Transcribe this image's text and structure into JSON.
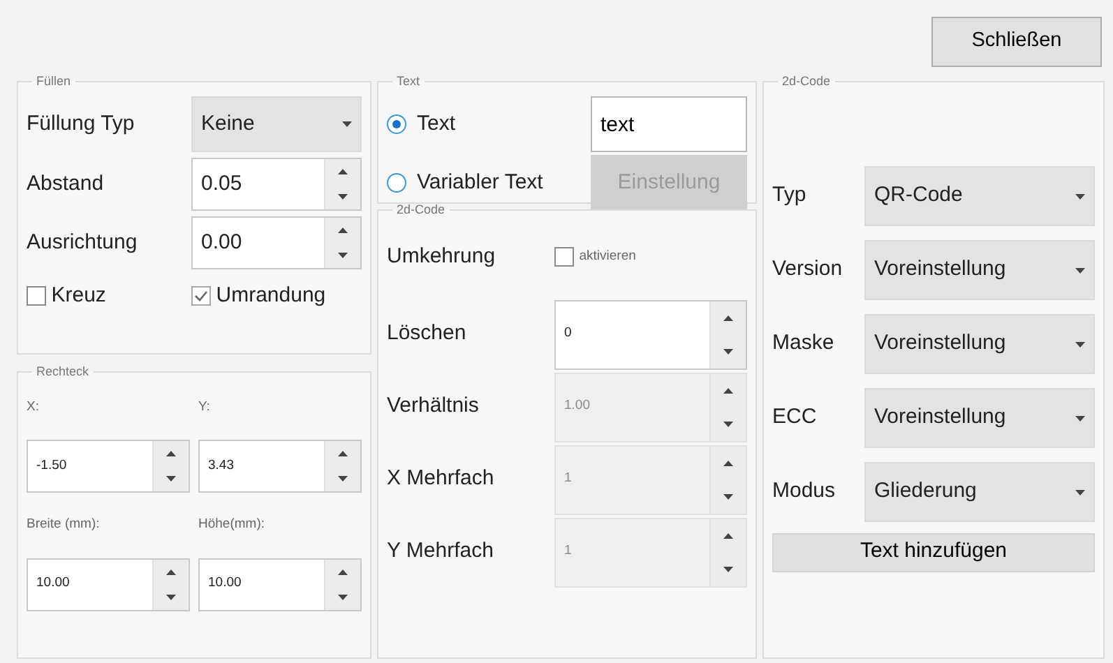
{
  "close_button": "Schließen",
  "fill": {
    "title": "Füllen",
    "rows": [
      {
        "kind": "select",
        "label": "Füllung Typ",
        "value": "Keine"
      },
      {
        "kind": "spin",
        "label": "Abstand",
        "value": "0.05"
      },
      {
        "kind": "spin",
        "label": "Ausrichtung",
        "value": "0.00"
      }
    ],
    "checks": [
      {
        "label": "Kreuz",
        "checked": false
      },
      {
        "label": "Umrandung",
        "checked": true
      }
    ]
  },
  "rect": {
    "title": "Rechteck",
    "fields": [
      {
        "label": "X:",
        "value": "-1.50"
      },
      {
        "label": "Y:",
        "value": "3.43"
      },
      {
        "label": "Breite (mm):",
        "value": "10.00"
      },
      {
        "label": "Höhe(mm):",
        "value": "10.00"
      }
    ]
  },
  "text": {
    "title": "Text",
    "options": [
      {
        "label": "Text",
        "selected": true,
        "kind": "input",
        "value": "text"
      },
      {
        "label": "Variabler Text",
        "selected": false,
        "kind": "button",
        "value": "Einstellung",
        "disabled": true
      }
    ]
  },
  "code_settings": {
    "title": "2d-Code",
    "invert": {
      "label": "Umkehrung",
      "check_label": "aktivieren",
      "checked": false
    },
    "spins": [
      {
        "label": "Löschen",
        "value": "0",
        "disabled": false
      },
      {
        "label": "Verhältnis",
        "value": "1.00",
        "disabled": true
      },
      {
        "label": "X Mehrfach",
        "value": "1",
        "disabled": true
      },
      {
        "label": "Y Mehrfach",
        "value": "1",
        "disabled": true
      }
    ]
  },
  "code_type": {
    "title": "2d-Code",
    "selects": [
      {
        "label": "Typ",
        "value": "QR-Code"
      },
      {
        "label": "Version",
        "value": "Voreinstellung"
      },
      {
        "label": "Maske",
        "value": "Voreinstellung"
      },
      {
        "label": "ECC",
        "value": "Voreinstellung"
      },
      {
        "label": "Modus",
        "value": "Gliederung"
      }
    ],
    "add_button": "Text hinzufügen"
  }
}
